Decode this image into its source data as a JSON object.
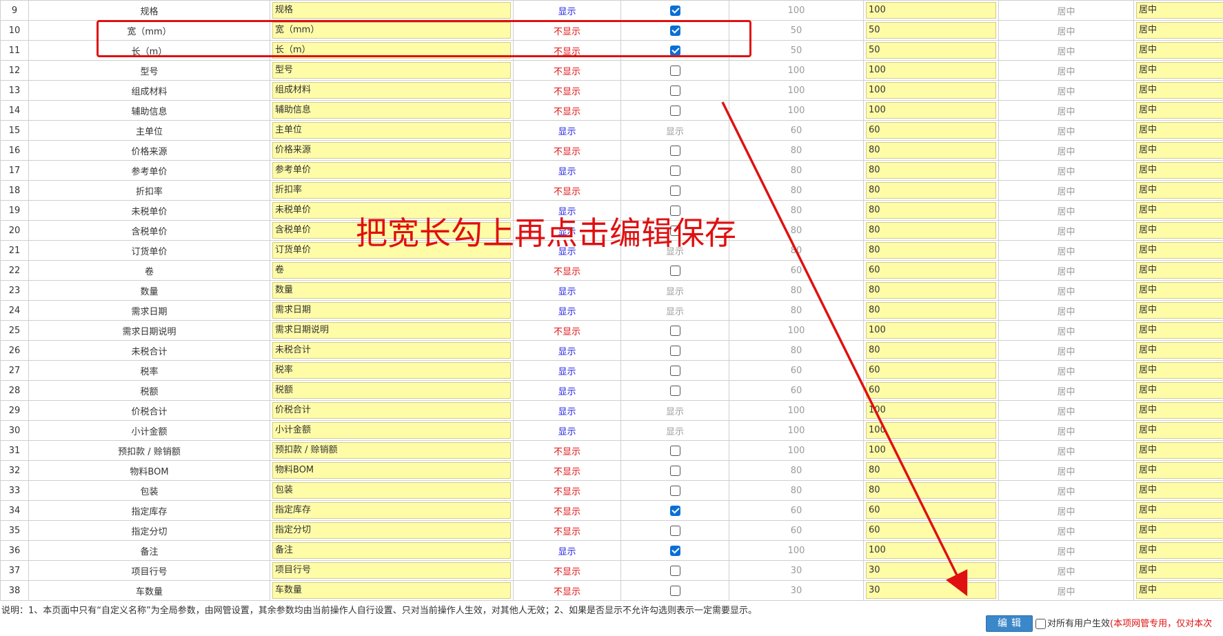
{
  "rows": [
    {
      "index": "9",
      "name": "规格",
      "custom": "规格",
      "display": "显示",
      "display_type": "show",
      "check": "on",
      "default_width": "100",
      "width": "100",
      "align_label": "居中",
      "align_value": "居中"
    },
    {
      "index": "10",
      "name": "宽（mm）",
      "custom": "宽（mm）",
      "display": "不显示",
      "display_type": "noshow",
      "check": "on",
      "default_width": "50",
      "width": "50",
      "align_label": "居中",
      "align_value": "居中"
    },
    {
      "index": "11",
      "name": "长（m）",
      "custom": "长（m）",
      "display": "不显示",
      "display_type": "noshow",
      "check": "on",
      "default_width": "50",
      "width": "50",
      "align_label": "居中",
      "align_value": "居中"
    },
    {
      "index": "12",
      "name": "型号",
      "custom": "型号",
      "display": "不显示",
      "display_type": "noshow",
      "check": "off",
      "default_width": "100",
      "width": "100",
      "align_label": "居中",
      "align_value": "居中"
    },
    {
      "index": "13",
      "name": "组成材料",
      "custom": "组成材料",
      "display": "不显示",
      "display_type": "noshow",
      "check": "off",
      "default_width": "100",
      "width": "100",
      "align_label": "居中",
      "align_value": "居中"
    },
    {
      "index": "14",
      "name": "辅助信息",
      "custom": "辅助信息",
      "display": "不显示",
      "display_type": "noshow",
      "check": "off",
      "default_width": "100",
      "width": "100",
      "align_label": "居中",
      "align_value": "居中"
    },
    {
      "index": "15",
      "name": "主单位",
      "custom": "主单位",
      "display": "显示",
      "display_type": "show",
      "check": "text",
      "check_text": "显示",
      "default_width": "60",
      "width": "60",
      "align_label": "居中",
      "align_value": "居中"
    },
    {
      "index": "16",
      "name": "价格来源",
      "custom": "价格来源",
      "display": "不显示",
      "display_type": "noshow",
      "check": "off",
      "default_width": "80",
      "width": "80",
      "align_label": "居中",
      "align_value": "居中"
    },
    {
      "index": "17",
      "name": "参考单价",
      "custom": "参考单价",
      "display": "显示",
      "display_type": "show",
      "check": "off",
      "default_width": "80",
      "width": "80",
      "align_label": "居中",
      "align_value": "居中"
    },
    {
      "index": "18",
      "name": "折扣率",
      "custom": "折扣率",
      "display": "不显示",
      "display_type": "noshow",
      "check": "off",
      "default_width": "80",
      "width": "80",
      "align_label": "居中",
      "align_value": "居中"
    },
    {
      "index": "19",
      "name": "未税单价",
      "custom": "未税单价",
      "display": "显示",
      "display_type": "show",
      "check": "off",
      "default_width": "80",
      "width": "80",
      "align_label": "居中",
      "align_value": "居中"
    },
    {
      "index": "20",
      "name": "含税单价",
      "custom": "含税单价",
      "display": "显示",
      "display_type": "show",
      "check": "off",
      "default_width": "80",
      "width": "80",
      "align_label": "居中",
      "align_value": "居中"
    },
    {
      "index": "21",
      "name": "订货单价",
      "custom": "订货单价",
      "display": "显示",
      "display_type": "show",
      "check": "text",
      "check_text": "显示",
      "default_width": "80",
      "width": "80",
      "align_label": "居中",
      "align_value": "居中"
    },
    {
      "index": "22",
      "name": "卷",
      "custom": "卷",
      "display": "不显示",
      "display_type": "noshow",
      "check": "off",
      "default_width": "60",
      "width": "60",
      "align_label": "居中",
      "align_value": "居中"
    },
    {
      "index": "23",
      "name": "数量",
      "custom": "数量",
      "display": "显示",
      "display_type": "show",
      "check": "text",
      "check_text": "显示",
      "default_width": "80",
      "width": "80",
      "align_label": "居中",
      "align_value": "居中"
    },
    {
      "index": "24",
      "name": "需求日期",
      "custom": "需求日期",
      "display": "显示",
      "display_type": "show",
      "check": "text",
      "check_text": "显示",
      "default_width": "80",
      "width": "80",
      "align_label": "居中",
      "align_value": "居中"
    },
    {
      "index": "25",
      "name": "需求日期说明",
      "custom": "需求日期说明",
      "display": "不显示",
      "display_type": "noshow",
      "check": "off",
      "default_width": "100",
      "width": "100",
      "align_label": "居中",
      "align_value": "居中"
    },
    {
      "index": "26",
      "name": "未税合计",
      "custom": "未税合计",
      "display": "显示",
      "display_type": "show",
      "check": "off",
      "default_width": "80",
      "width": "80",
      "align_label": "居中",
      "align_value": "居中"
    },
    {
      "index": "27",
      "name": "税率",
      "custom": "税率",
      "display": "显示",
      "display_type": "show",
      "check": "off",
      "default_width": "60",
      "width": "60",
      "align_label": "居中",
      "align_value": "居中"
    },
    {
      "index": "28",
      "name": "税额",
      "custom": "税额",
      "display": "显示",
      "display_type": "show",
      "check": "off",
      "default_width": "60",
      "width": "60",
      "align_label": "居中",
      "align_value": "居中"
    },
    {
      "index": "29",
      "name": "价税合计",
      "custom": "价税合计",
      "display": "显示",
      "display_type": "show",
      "check": "text",
      "check_text": "显示",
      "default_width": "100",
      "width": "100",
      "align_label": "居中",
      "align_value": "居中"
    },
    {
      "index": "30",
      "name": "小计金额",
      "custom": "小计金额",
      "display": "显示",
      "display_type": "show",
      "check": "text",
      "check_text": "显示",
      "default_width": "100",
      "width": "100",
      "align_label": "居中",
      "align_value": "居中"
    },
    {
      "index": "31",
      "name": "预扣款 / 赊销额",
      "custom": "预扣款 / 赊销额",
      "display": "不显示",
      "display_type": "noshow",
      "check": "off",
      "default_width": "100",
      "width": "100",
      "align_label": "居中",
      "align_value": "居中"
    },
    {
      "index": "32",
      "name": "物料BOM",
      "custom": "物料BOM",
      "display": "不显示",
      "display_type": "noshow",
      "check": "off",
      "default_width": "80",
      "width": "80",
      "align_label": "居中",
      "align_value": "居中"
    },
    {
      "index": "33",
      "name": "包装",
      "custom": "包装",
      "display": "不显示",
      "display_type": "noshow",
      "check": "off",
      "default_width": "80",
      "width": "80",
      "align_label": "居中",
      "align_value": "居中"
    },
    {
      "index": "34",
      "name": "指定库存",
      "custom": "指定库存",
      "display": "不显示",
      "display_type": "noshow",
      "check": "on",
      "default_width": "60",
      "width": "60",
      "align_label": "居中",
      "align_value": "居中"
    },
    {
      "index": "35",
      "name": "指定分切",
      "custom": "指定分切",
      "display": "不显示",
      "display_type": "noshow",
      "check": "off",
      "default_width": "60",
      "width": "60",
      "align_label": "居中",
      "align_value": "居中"
    },
    {
      "index": "36",
      "name": "备注",
      "custom": "备注",
      "display": "显示",
      "display_type": "show",
      "check": "on",
      "default_width": "100",
      "width": "100",
      "align_label": "居中",
      "align_value": "居中"
    },
    {
      "index": "37",
      "name": "项目行号",
      "custom": "项目行号",
      "display": "不显示",
      "display_type": "noshow",
      "check": "off",
      "default_width": "30",
      "width": "30",
      "align_label": "居中",
      "align_value": "居中"
    },
    {
      "index": "38",
      "name": "车数量",
      "custom": "车数量",
      "display": "不显示",
      "display_type": "noshow",
      "check": "off",
      "default_width": "30",
      "width": "30",
      "align_label": "居中",
      "align_value": "居中"
    }
  ],
  "footer": {
    "note": "说明：1、本页面中只有“自定义名称”为全局参数，由网管设置，其余参数均由当前操作人自行设置、只对当前操作人生效，对其他人无效；2、如果是否显示不允许勾选则表示一定需要显示。",
    "edit_button": "编辑",
    "all_users_label": "对所有用户生效",
    "all_users_note": "(本项网管专用，仅对本次"
  },
  "annotation": {
    "text": "把宽长勾上再点击编辑保存",
    "color": "#e01010"
  },
  "colors": {
    "input_bg": "#fffca8",
    "show_text": "#2020e0",
    "noshow_text": "#e01010",
    "checkbox_checked": "#0a6fd6",
    "button_bg": "#3a87c9"
  }
}
